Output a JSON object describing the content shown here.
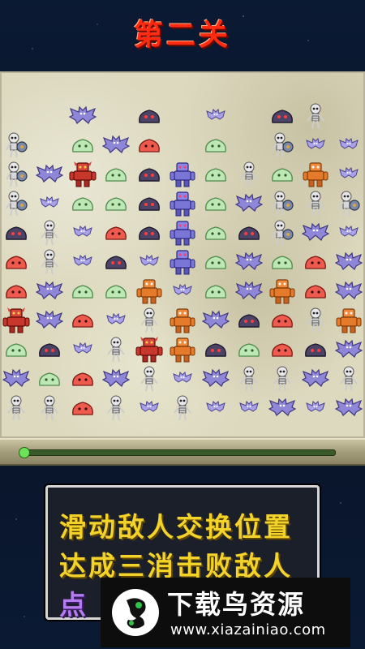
{
  "level_title": "第二关",
  "instructions": {
    "line1": "滑动敌人交换位置",
    "line2": "达成三消击败敌人",
    "line3": "点"
  },
  "watermark": {
    "title": "下载鸟资源",
    "url": "www.xiazainiao.com"
  },
  "progress": {
    "fraction": 0.0
  },
  "colors": {
    "title": "#ff2a12",
    "instruction_yellow": "#f3d22a",
    "instruction_purple": "#b47cf0",
    "progress_green": "#6ee05a"
  },
  "board": {
    "cols": 11,
    "rows": 13,
    "legend": {
      "B": "purple-bat",
      "D": "dark-slime",
      "G": "green-slime",
      "P": "red-slime",
      "K": "skeleton",
      "O": "orange-golem",
      "R": "red-golem",
      "V": "blue-golem",
      "S": "shield-skeleton",
      "W": "small-bat",
      "-": "empty"
    },
    "grid": [
      "--B-D-W-DK-",
      "S-GBP-G-SWW",
      "SBRGDVGKGOW",
      "SWGGDVGBSKS",
      "DKWPDVGDSBW",
      "PKWDWVGBGPB",
      "PBGGOWGBOPB",
      "RBPWKOBDPKO",
      "GDWKRODGPDB",
      "BGPBKWBKKBK",
      "KKPKWKWWBWB"
    ]
  }
}
